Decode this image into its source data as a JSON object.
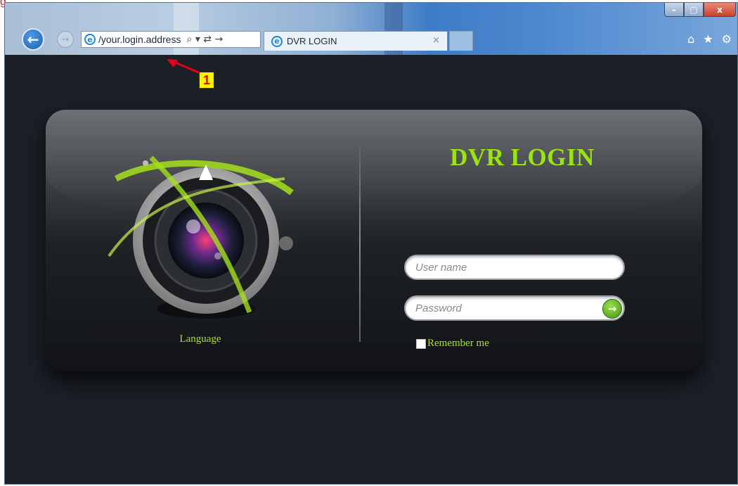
{
  "corner_mark": "g",
  "browser": {
    "address": "/your.login.address",
    "address_tools": "⌕ ▾ ⇄ →",
    "tab_title": "DVR LOGIN",
    "tab_close": "×",
    "window_buttons": {
      "minimize": "–",
      "maximize": "▢",
      "close": "x"
    },
    "icons": [
      "back-arrow-icon",
      "forward-arrow-icon",
      "ie-logo-icon",
      "search-icon",
      "home-icon",
      "favorites-star-icon",
      "settings-gear-icon"
    ]
  },
  "annotation": {
    "badge": "1",
    "arrow_color": "#e3001b",
    "badge_color": "#fff200"
  },
  "login": {
    "title": "DVR LOGIN",
    "username_placeholder": "User name",
    "password_placeholder": "Password",
    "remember_label": "Remember me",
    "language_label": "Language"
  },
  "colors": {
    "accent_green": "#9be60a",
    "page_background": "#1b1f26",
    "panel": "#2b2e33"
  }
}
